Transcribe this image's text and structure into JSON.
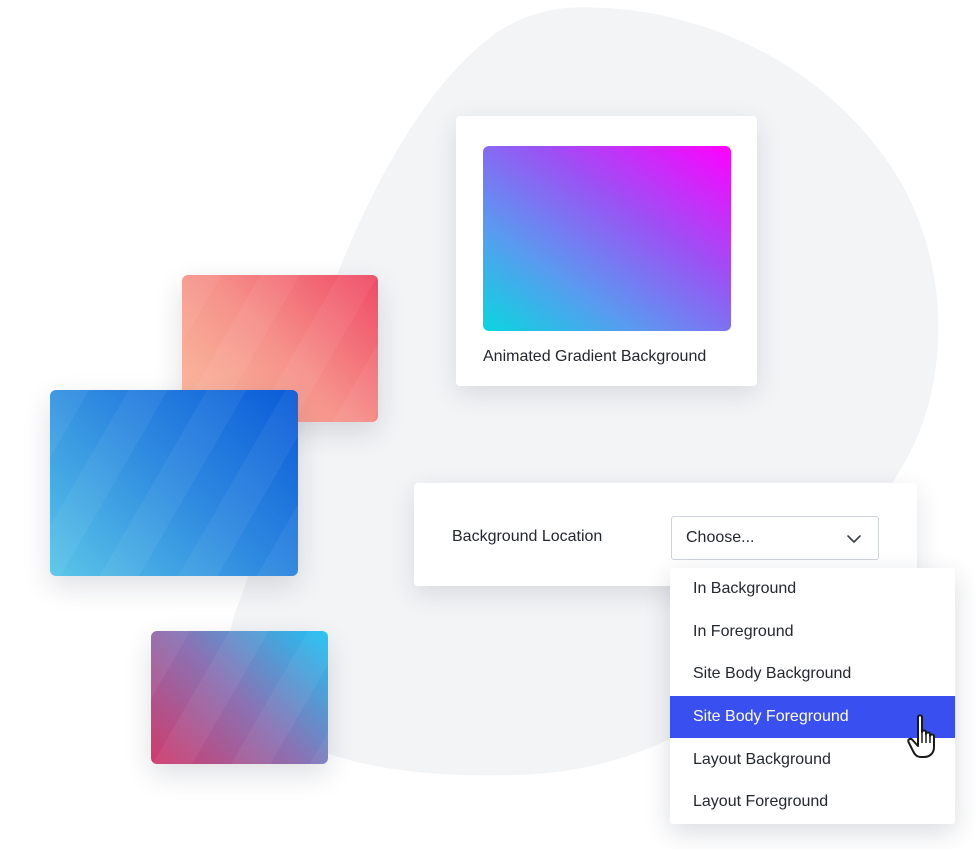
{
  "preview": {
    "caption": "Animated Gradient Background"
  },
  "settings": {
    "label": "Background Location",
    "select_value": "Choose..."
  },
  "dropdown": {
    "options": [
      "In Background",
      "In Foreground",
      "Site Body Background",
      "Site Body Foreground",
      "Layout Background",
      "Layout Foreground"
    ],
    "selected": "Site Body Foreground"
  },
  "icons": {
    "select_chevron": "chevron-down-icon",
    "pointer": "hand-pointer-icon"
  },
  "colors": {
    "selected_option": "#3a4ff0",
    "blob": "#f3f4f6"
  }
}
